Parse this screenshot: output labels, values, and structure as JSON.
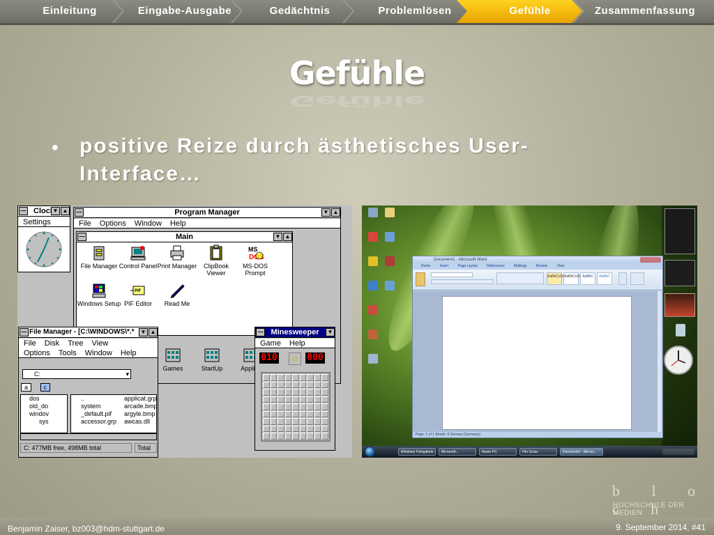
{
  "nav": {
    "items": [
      {
        "label": "Einleitung"
      },
      {
        "label": "Eingabe-Ausgabe"
      },
      {
        "label": "Gedächtnis"
      },
      {
        "label": "Problemlösen"
      },
      {
        "label": "Gefühle"
      },
      {
        "label": "Zusammenfassung"
      }
    ],
    "active_color": "#f5b800"
  },
  "slide": {
    "title": "Gefühle",
    "bullet": "positive Reize durch ästhetisches User-Interface…"
  },
  "win31": {
    "clock": {
      "title": "Clock",
      "menu": "Settings"
    },
    "program_manager": {
      "title": "Program Manager",
      "menu": [
        "File",
        "Options",
        "Window",
        "Help"
      ]
    },
    "main_group": {
      "title": "Main",
      "icons": [
        {
          "label": "File Manager"
        },
        {
          "label": "Control Panel"
        },
        {
          "label": "Print Manager"
        },
        {
          "label": "ClipBook Viewer"
        },
        {
          "label": "MS-DOS Prompt"
        },
        {
          "label": "Windows Setup"
        },
        {
          "label": "PIF Editor"
        },
        {
          "label": "Read Me"
        }
      ]
    },
    "group_icons": [
      {
        "label": "Games"
      },
      {
        "label": "StartUp"
      },
      {
        "label": "Applica"
      }
    ],
    "file_manager": {
      "title": "File Manager - [C:\\WINDOWS\\*.*",
      "menu1": [
        "File",
        "Disk",
        "Tree",
        "View"
      ],
      "menu2": [
        "Options",
        "Tools",
        "Window",
        "Help"
      ],
      "drive": "C:",
      "drives": [
        "a",
        "c"
      ],
      "tree": [
        "dos",
        "old_do",
        "windov",
        "sys"
      ],
      "files_col1": [
        "..",
        "system",
        "_default.pif",
        "accessor.grp"
      ],
      "files_col2": [
        "applicat.grp",
        "arcade.bmp",
        "argyle.bmp",
        "awcas.dll"
      ],
      "status_free": "C: 477MB free,  498MB total",
      "status_total": "Total"
    },
    "minesweeper": {
      "title": "Minesweeper",
      "menu": [
        "Game",
        "Help"
      ],
      "counter_left": "010",
      "counter_right": "000"
    }
  },
  "vista": {
    "word_title": "Document1 - Microsoft Word",
    "word_tabs": [
      "Home",
      "Insert",
      "Page Layout",
      "References",
      "Mailings",
      "Review",
      "View"
    ],
    "styles": [
      "AaBbCcDc",
      "AaBbCcDc",
      "AaBbC",
      "AaBbC"
    ],
    "status": "Page: 1 of 1   Words: 0   German (Germany)",
    "taskbar": [
      "Windows Fotogalerie",
      "Microsoft...",
      "Neuer PC",
      "File Gross",
      "Document1 - Micros..."
    ]
  },
  "logo": {
    "mark": "b l o c h",
    "text": "HOCHSCHULE DER MEDIEN"
  },
  "footer": {
    "author": "Benjamin Zaiser, bz003@hdm-stuttgart.de",
    "date_page": "9. September 2014, #41"
  }
}
